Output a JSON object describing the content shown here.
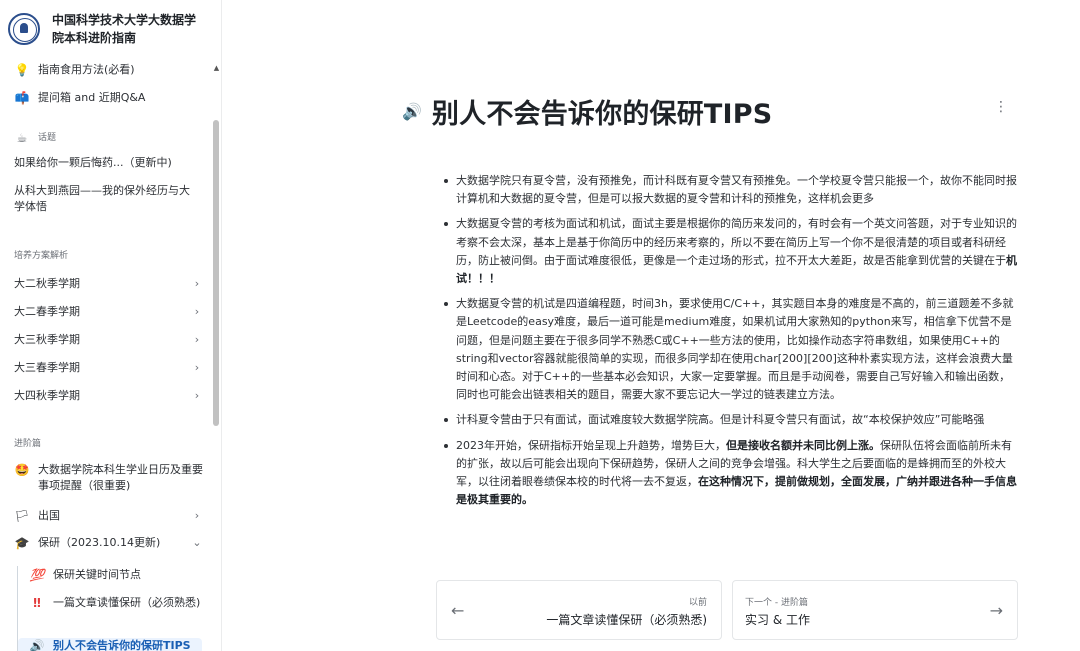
{
  "site": {
    "title": "中国科学技术大学大数据学院本科进阶指南"
  },
  "sidebar": {
    "top_items": [
      {
        "icon": "lightbulb-icon",
        "glyph": "💡",
        "label": "指南食用方法(必看)"
      },
      {
        "icon": "mailbox-icon",
        "glyph": "📫",
        "label": "提问箱 and 近期Q&A"
      }
    ],
    "sections": {
      "topics": {
        "icon": "coffee-icon",
        "glyph": "☕",
        "label": "话题"
      },
      "training": {
        "label": "培养方案解析"
      },
      "advanced": {
        "label": "进阶篇"
      }
    },
    "topic_items": [
      {
        "label": "如果给你一颗后悔药...（更新中)"
      },
      {
        "label": "从科大到燕园——我的保外经历与大学体悟"
      }
    ],
    "training_items": [
      {
        "label": "大二秋季学期"
      },
      {
        "label": "大二春季学期"
      },
      {
        "label": "大三秋季学期"
      },
      {
        "label": "大三春季学期"
      },
      {
        "label": "大四秋季学期"
      }
    ],
    "advanced_items": [
      {
        "icon": "star-eyes-icon",
        "glyph": "🤩",
        "label": "大数据学院本科生学业日历及重要事项提醒（很重要)"
      },
      {
        "icon": "flag-icon",
        "glyph": "🏳",
        "label": "出国"
      },
      {
        "icon": "graduation-cap-icon",
        "glyph": "🎓",
        "label": "保研（2023.10.14更新)"
      }
    ],
    "baoyan_children": [
      {
        "icon": "hundred-icon",
        "glyph": "💯",
        "label": "保研关键时间节点"
      },
      {
        "icon": "double-exclamation-icon",
        "glyph": "‼",
        "label": "一篇文章读懂保研（必须熟悉)"
      },
      {
        "icon": "speaker-icon",
        "glyph": "🔊",
        "label": "别人不会告诉你的保研TIPS"
      }
    ]
  },
  "page": {
    "title_icon": "speaker-icon",
    "title_glyph": "🔊",
    "title": "别人不会告诉你的保研TIPS",
    "more_glyph": "⋮",
    "bullets": [
      {
        "text": "大数据学院只有夏令营，没有预推免，而计科既有夏令营又有预推免。一个学校夏令营只能报一个，故你不能同时报计算机和大数据的夏令营，但是可以报大数据的夏令营和计科的预推免，这样机会更多"
      },
      {
        "text": "大数据夏令营的考核为面试和机试，面试主要是根据你的简历来发问的，有时会有一个英文问答题，对于专业知识的考察不会太深，基本上是基于你简历中的经历来考察的，所以不要在简历上写一个你不是很清楚的项目或者科研经历，防止被问倒。由于面试难度很低，更像是一个走过场的形式，拉不开太大差距，故是否能拿到优营的关键在于",
        "bold": "机试！！！"
      },
      {
        "text": "大数据夏令营的机试是四道编程题，时间3h，要求使用C/C++，其实题目本身的难度是不高的，前三道题差不多就是Leetcode的easy难度，最后一道可能是medium难度，如果机试用大家熟知的python来写，相信拿下优营不是问题，但是问题主要在于很多同学不熟悉C或C++一些方法的使用，比如操作动态字符串数组，如果使用C++的string和vector容器就能很简单的实现，而很多同学却在使用char[200][200]这种朴素实现方法，这样会浪费大量时间和心态。对于C++的一些基本必会知识，大家一定要掌握。而且是手动阅卷，需要自己写好输入和输出函数，同时也可能会出链表相关的题目，需要大家不要忘记大一学过的链表建立方法。"
      },
      {
        "text": "计科夏令营由于只有面试，面试难度较大数据学院高。但是计科夏令营只有面试，故“本校保护效应”可能略强"
      },
      {
        "text_a": "2023年开始，保研指标开始呈现上升趋势，增势巨大，",
        "bold_a": "但是接收名额并未同比例上涨。",
        "text_b": "保研队伍将会面临前所未有的扩张，故以后可能会出现向下保研趋势，保研人之间的竞争会增强。科大学生之后要面临的是蜂拥而至的外校大军，以往闭着眼卷绩保本校的时代将一去不复返，",
        "bold_b": "在这种情况下，提前做规划，全面发展，广纳并跟进各种一手信息是极其重要的。"
      }
    ]
  },
  "pager": {
    "prev": {
      "small": "以前",
      "label": "一篇文章读懂保研（必须熟悉)",
      "arrow": "←"
    },
    "next": {
      "small": "下一个 - 进阶篇",
      "label": "实习 & 工作",
      "arrow": "→"
    }
  },
  "chevrons": {
    "right": "›",
    "down": "⌄",
    "up": "▲"
  }
}
